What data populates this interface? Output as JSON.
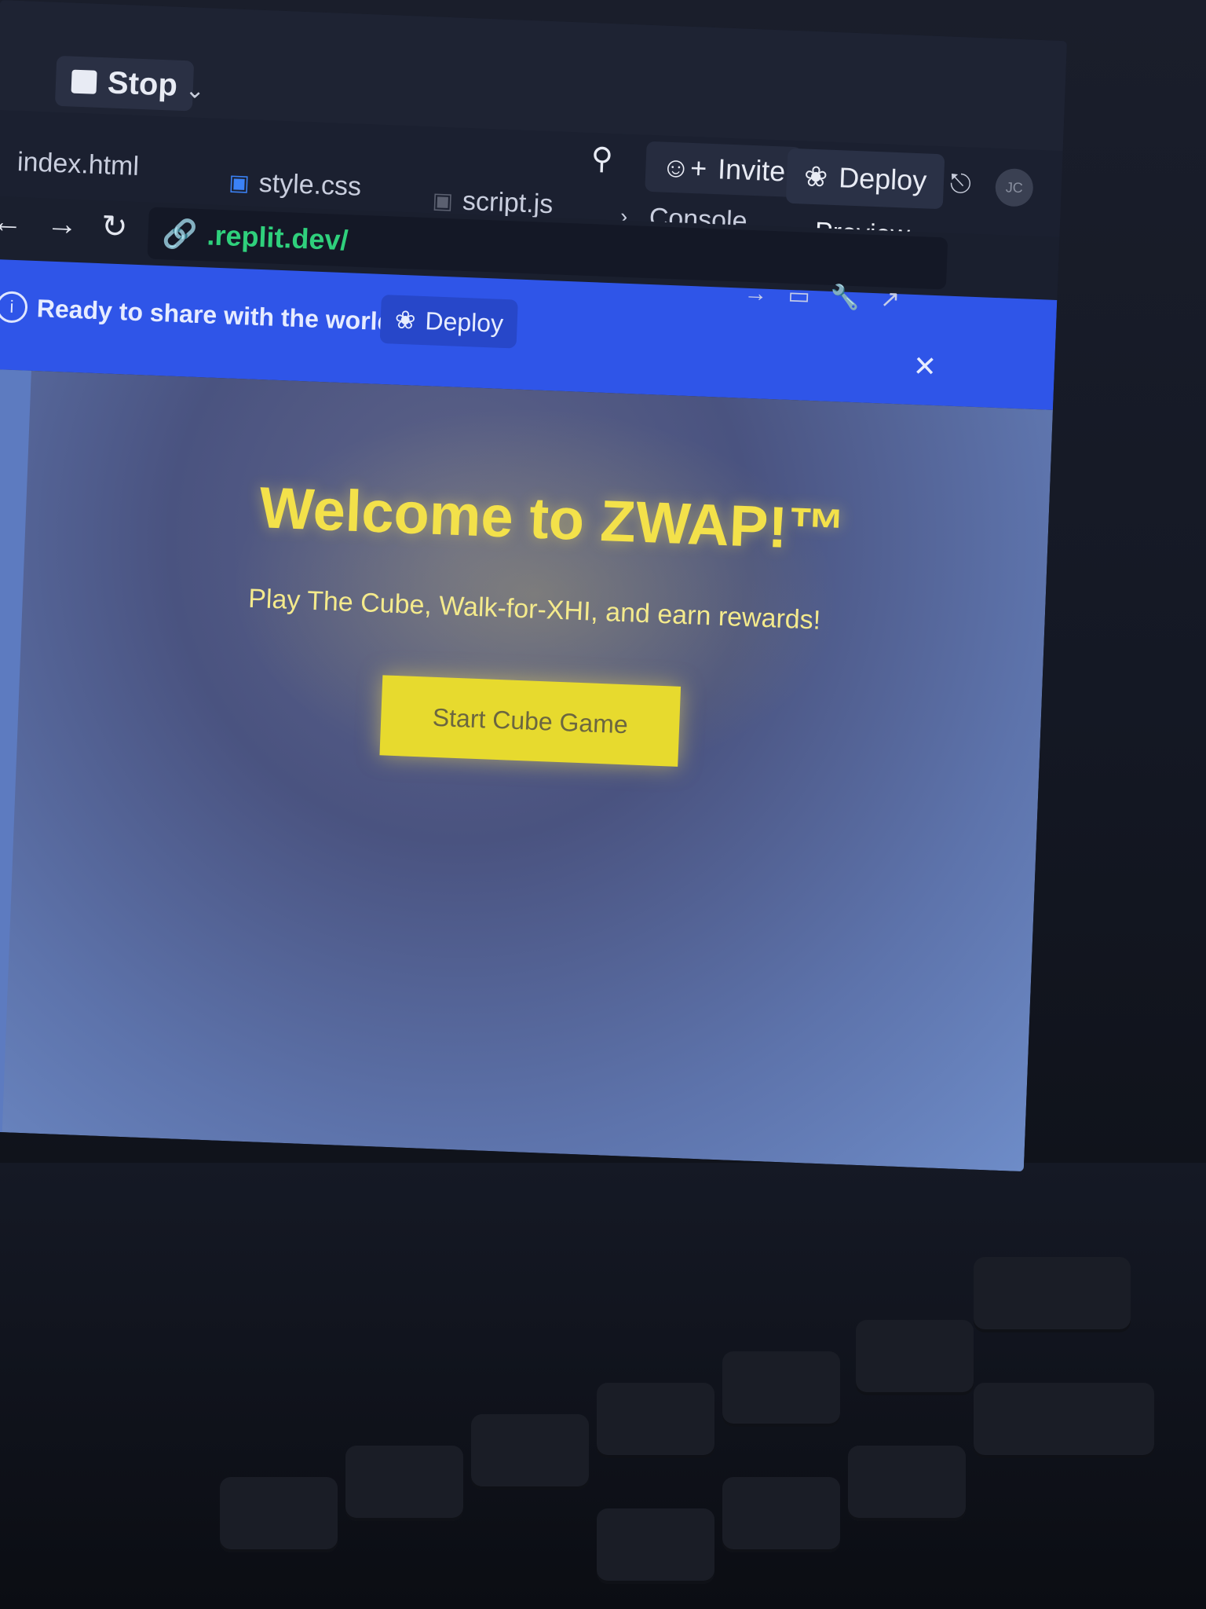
{
  "toolbar": {
    "stop_label": "Stop",
    "invite_label": "Invite",
    "deploy_label": "Deploy",
    "avatar_initials": "JC"
  },
  "tabs": [
    {
      "label": "index.html"
    },
    {
      "label": "style.css"
    },
    {
      "label": "script.js"
    },
    {
      "label": "Console"
    },
    {
      "label": "Preview"
    }
  ],
  "navbar": {
    "url": ".replit.dev/"
  },
  "banner": {
    "text": "Ready to share with the world?",
    "deploy_label": "Deploy"
  },
  "page": {
    "title": "Welcome to ZWAP!™",
    "subtitle": "Play The Cube, Walk-for-XHI, and earn rewards!",
    "start_button": "Start Cube Game"
  },
  "colors": {
    "accent_blue": "#2f55e8",
    "title_yellow": "#f3e14a",
    "button_yellow": "#e7da2e",
    "url_green": "#2fd07c"
  }
}
